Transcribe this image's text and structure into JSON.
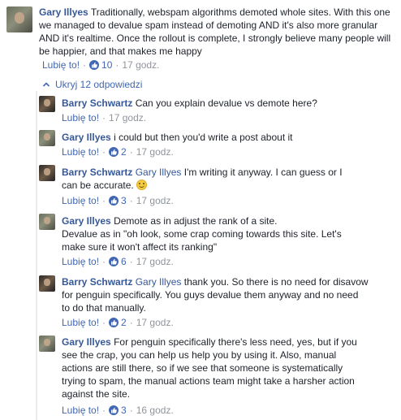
{
  "ui": {
    "like_label": "Lubię to!",
    "separator": "·",
    "hide_replies_label": "Ukryj 12 odpowiedzi",
    "like_color": "#4267b2",
    "name_color": "#365899"
  },
  "root": {
    "author": "Gary Illyes",
    "text": "Traditionally, webspam algorithms demoted whole sites. With this one we managed to devalue spam instead of demoting AND it's also more granular AND it's realtime. Once the rollout is complete, I strongly believe many people will be happier, and that makes me happy",
    "likes": "10",
    "time": "17 godz.",
    "avatar_icon": "profile-photo-icon"
  },
  "replies": [
    {
      "author": "Barry Schwartz",
      "mention": "",
      "text": "Can you explain devalue vs demote here?",
      "likes": "",
      "time": "17 godz."
    },
    {
      "author": "Gary Illyes",
      "mention": "",
      "text": "i could but then you'd write a post about it",
      "likes": "2",
      "time": "17 godz."
    },
    {
      "author": "Barry Schwartz",
      "mention": "Gary Illyes",
      "text": "I'm writing it anyway. I can guess or I can be accurate.",
      "likes": "3",
      "time": "17 godz.",
      "emoji": "smiley-emoji-icon"
    },
    {
      "author": "Gary Illyes",
      "mention": "",
      "text": "Demote as in adjust the rank of a site.",
      "text2": "Devalue as in \"oh look, some crap coming towards this site. Let's make sure it won't affect its ranking\"",
      "likes": "6",
      "time": "17 godz."
    },
    {
      "author": "Barry Schwartz",
      "mention": "Gary Illyes",
      "text": "thank you. So there is no need for disavow for penguin specifically. You guys devalue them anyway and no need to do that manually.",
      "likes": "2",
      "time": "17 godz."
    },
    {
      "author": "Gary Illyes",
      "mention": "",
      "text": "For penguin specifically there's less need, yes, but if you see the crap, you can help us help you by using it. Also, manual actions are still there, so if we see that someone is systematically trying to spam, the manual actions team might take a harsher action against the site.",
      "likes": "3",
      "time": "16 godz."
    }
  ]
}
